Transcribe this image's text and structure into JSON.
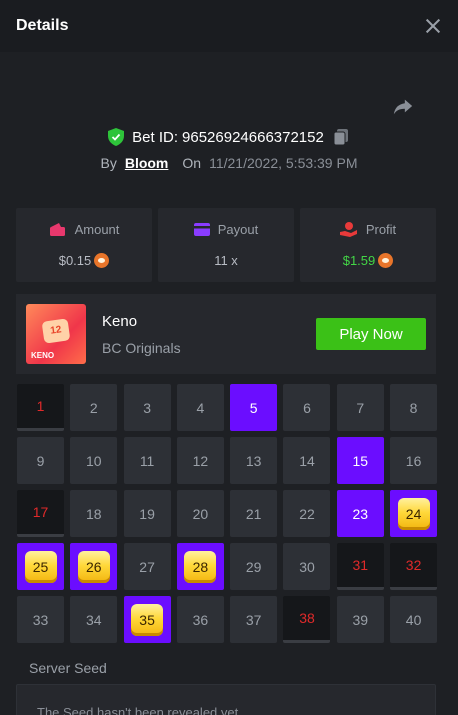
{
  "header": {
    "title": "Details"
  },
  "bet": {
    "id_label": "Bet ID:",
    "id": "96526924666372152",
    "by_label": "By",
    "user": "Bloom",
    "on_label": "On",
    "datetime": "11/21/2022, 5:53:39 PM"
  },
  "stats": {
    "amount": {
      "label": "Amount",
      "value": "$0.15",
      "icon": "wallet-icon",
      "icon_color": "#e8386d"
    },
    "payout": {
      "label": "Payout",
      "value": "11 x",
      "icon": "card-icon",
      "icon_color": "#8a3cff"
    },
    "profit": {
      "label": "Profit",
      "value": "$1.59",
      "icon": "hand-coin-icon",
      "icon_color": "#e83a3a",
      "value_color": "#43d646"
    }
  },
  "game": {
    "thumb_number": "12",
    "thumb_label": "KENO",
    "name": "Keno",
    "provider": "BC Originals",
    "play_label": "Play Now"
  },
  "grid": {
    "numbers": [
      "1",
      "2",
      "3",
      "4",
      "5",
      "6",
      "7",
      "8",
      "9",
      "10",
      "11",
      "12",
      "13",
      "14",
      "15",
      "16",
      "17",
      "18",
      "19",
      "20",
      "21",
      "22",
      "23",
      "24",
      "25",
      "26",
      "27",
      "28",
      "29",
      "30",
      "31",
      "32",
      "33",
      "34",
      "35",
      "36",
      "37",
      "38",
      "39",
      "40"
    ],
    "picked_only": [
      5,
      15,
      23
    ],
    "hits": [
      24,
      25,
      26,
      28,
      35
    ],
    "drawn_miss": [
      1,
      17,
      31,
      32,
      38
    ]
  },
  "seed": {
    "label": "Server Seed",
    "placeholder": "The Seed hasn't been revealed yet"
  },
  "colors": {
    "accent_purple": "#6b0dff",
    "play_green": "#3bc117",
    "miss_red": "#e02a2a",
    "verified_green": "#2ec43a"
  }
}
